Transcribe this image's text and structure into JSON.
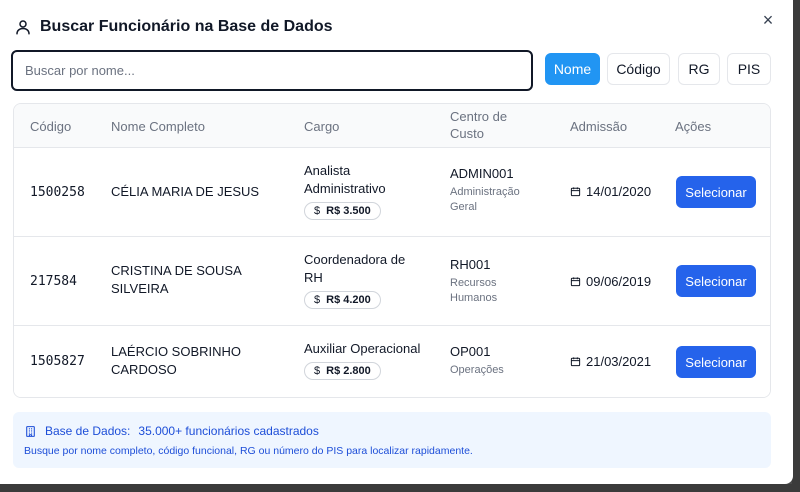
{
  "dialog": {
    "title": "Buscar Funcionário na Base de Dados",
    "close_label": "×"
  },
  "search": {
    "placeholder": "Buscar por nome...",
    "value": "",
    "modes": [
      "Nome",
      "Código",
      "RG",
      "PIS"
    ],
    "active_mode": "Nome"
  },
  "table": {
    "headers": {
      "codigo": "Código",
      "nome": "Nome Completo",
      "cargo": "Cargo",
      "centro": "Centro de Custo",
      "admissao": "Admissão",
      "acoes": "Ações"
    },
    "rows": [
      {
        "codigo": "1500258",
        "nome": "CÉLIA MARIA DE JESUS",
        "cargo": "Analista Administrativo",
        "salario": "R$ 3.500",
        "cc_code": "ADMIN001",
        "cc_desc": "Administração Geral",
        "admissao": "14/01/2020",
        "action": "Selecionar"
      },
      {
        "codigo": "217584",
        "nome": "CRISTINA DE SOUSA SILVEIRA",
        "cargo": "Coordenadora de RH",
        "salario": "R$ 4.200",
        "cc_code": "RH001",
        "cc_desc": "Recursos Humanos",
        "admissao": "09/06/2019",
        "action": "Selecionar"
      },
      {
        "codigo": "1505827",
        "nome": "LAÉRCIO SOBRINHO CARDOSO",
        "cargo": "Auxiliar Operacional",
        "salario": "R$ 2.800",
        "cc_code": "OP001",
        "cc_desc": "Operações",
        "admissao": "21/03/2021",
        "action": "Selecionar"
      }
    ]
  },
  "info": {
    "label": "Base de Dados:",
    "count": "35.000+ funcionários cadastrados",
    "hint": "Busque por nome completo, código funcional, RG ou número do PIS para localizar rapidamente."
  },
  "icons": {
    "title_icon": "user-icon",
    "salary_icon": "dollar-icon",
    "date_icon": "calendar-icon",
    "info_icon": "building-icon"
  },
  "colors": {
    "accent": "#2195f3",
    "button": "#2563eb",
    "info_bg": "#eff6ff",
    "info_text": "#1d4ed8"
  }
}
